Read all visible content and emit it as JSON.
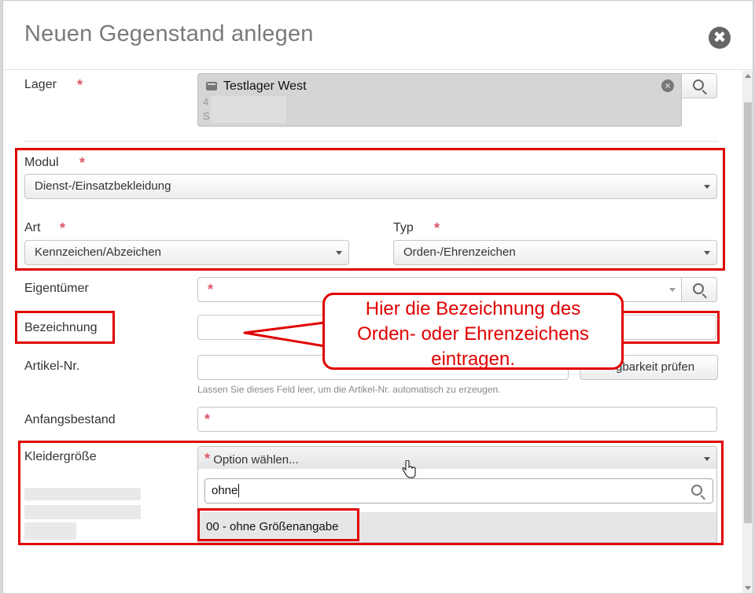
{
  "modal": {
    "title": "Neuen Gegenstand anlegen",
    "close_glyph": "✖"
  },
  "fields": {
    "lager": {
      "label": "Lager",
      "value": "Testlager West",
      "line2": "4",
      "line3": "S",
      "required": "*"
    },
    "modul": {
      "label": "Modul",
      "value": "Dienst-/Einsatzbekleidung",
      "required": "*"
    },
    "art": {
      "label": "Art",
      "value": "Kennzeichen/Abzeichen",
      "required": "*"
    },
    "typ": {
      "label": "Typ",
      "value": "Orden-/Ehrenzeichen",
      "required": "*"
    },
    "eigentuemer": {
      "label": "Eigentümer",
      "required": "*"
    },
    "bezeichnung": {
      "label": "Bezeichnung",
      "value": ""
    },
    "artikel_nr": {
      "label": "Artikel-Nr.",
      "value": "",
      "hint": "Lassen Sie dieses Feld leer, um die Artikel-Nr. automatisch zu erzeugen.",
      "check_button": "Verfügbarkeit prüfen",
      "check_button_visible": "gbarkeit prüfen"
    },
    "anfangsbestand": {
      "label": "Anfangsbestand",
      "required": "*"
    },
    "kleidergroesse": {
      "label": "Kleidergröße",
      "required": "*",
      "placeholder": "Option wählen...",
      "search_value": "ohne",
      "options": [
        "00 - ohne Größenangabe"
      ]
    }
  },
  "callout": {
    "line1": "Hier die Bezeichnung des",
    "line2": "Orden- oder Ehrenzeichens",
    "line3": "eintragen."
  },
  "colors": {
    "highlight": "#e00000",
    "required": "#e0566a",
    "title": "#7a7a7a"
  },
  "icons": {
    "close": "close-icon",
    "search": "search-icon",
    "warehouse": "warehouse-icon",
    "clear": "clear-icon",
    "caret": "chevron-down-icon",
    "pointer": "hand-cursor-icon"
  }
}
